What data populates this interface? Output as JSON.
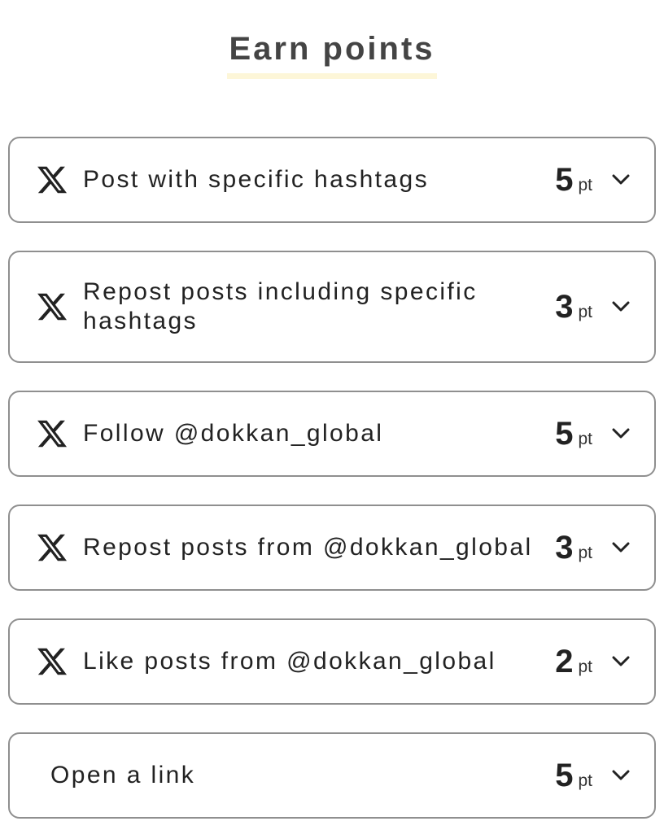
{
  "header": {
    "title": "Earn points"
  },
  "tasks": [
    {
      "icon": "x-logo-icon",
      "label": "Post with specific hashtags",
      "points": "5",
      "unit": "pt"
    },
    {
      "icon": "x-logo-icon",
      "label": "Repost posts including specific hashtags",
      "points": "3",
      "unit": "pt"
    },
    {
      "icon": "x-logo-icon",
      "label": "Follow @dokkan_global",
      "points": "5",
      "unit": "pt"
    },
    {
      "icon": "x-logo-icon",
      "label": "Repost posts from @dokkan_global",
      "points": "3",
      "unit": "pt"
    },
    {
      "icon": "x-logo-icon",
      "label": "Like posts from @dokkan_global",
      "points": "2",
      "unit": "pt"
    },
    {
      "icon": "",
      "label": "Open a link",
      "points": "5",
      "unit": "pt"
    }
  ],
  "colors": {
    "border": "#8f8f8f",
    "title_underline": "#fdf6d8",
    "text": "#222222"
  }
}
